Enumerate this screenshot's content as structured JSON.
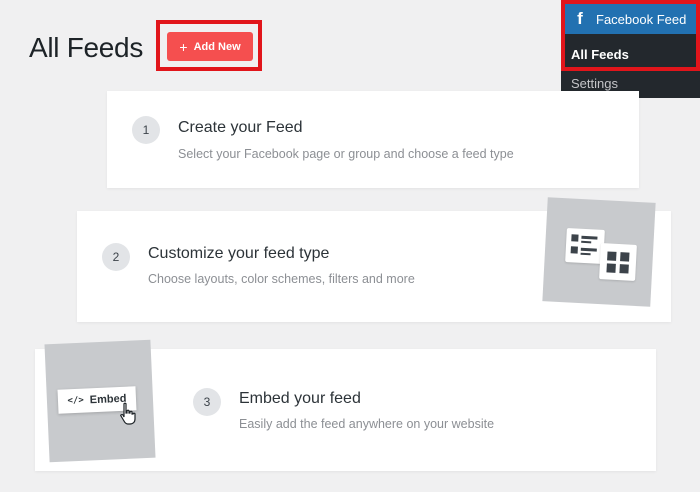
{
  "header": {
    "title": "All Feeds",
    "add_new_label": "Add New",
    "add_new_icon": "plus-icon"
  },
  "admin_menu": {
    "parent_label": "Facebook Feed",
    "parent_icon": "facebook-icon",
    "items": [
      {
        "label": "All Feeds",
        "active": true
      },
      {
        "label": "Settings",
        "active": false
      }
    ],
    "colors": {
      "bar": "#23282d",
      "active_parent": "#2271b1",
      "highlight": "#e1151b"
    }
  },
  "steps": [
    {
      "number": "1",
      "title": "Create your Feed",
      "description": "Select your Facebook page or group and choose a feed type"
    },
    {
      "number": "2",
      "title": "Customize your feed type",
      "description": "Choose layouts, color schemes, filters and more"
    },
    {
      "number": "3",
      "title": "Embed your feed",
      "description": "Easily add the feed anywhere on your website"
    }
  ],
  "illustrations": {
    "embed_label": "Embed",
    "embed_icon": "code-icon",
    "cursor_icon": "hand-cursor-icon",
    "layout_icon": "layout-grid-icon"
  },
  "colors": {
    "accent": "#f54f4f",
    "page_bg": "#f0f0f1"
  }
}
